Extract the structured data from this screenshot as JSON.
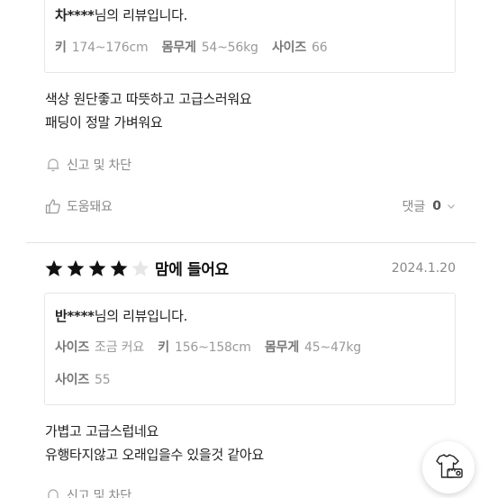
{
  "review1": {
    "reviewer_name": "차****",
    "reviewer_suffix": "님의 리뷰입니다.",
    "specs": [
      {
        "key": "키",
        "value": "174~176cm"
      },
      {
        "key": "몸무게",
        "value": "54~56kg"
      },
      {
        "key": "사이즈",
        "value": "66"
      }
    ],
    "body_lines": [
      "색상 원단좋고 따뜻하고 고급스러워요",
      "패딩이 정말 가벼워요"
    ],
    "report_label": "신고 및 차단",
    "helpful_label": "도움돼요",
    "comments_label": "댓글",
    "comments_count": "0"
  },
  "review2": {
    "rating": 4,
    "max_rating": 5,
    "rating_text": "맘에 들어요",
    "date": "2024.1.20",
    "reviewer_name": "반****",
    "reviewer_suffix": "님의 리뷰입니다.",
    "specs_row1": [
      {
        "key": "사이즈",
        "value": "조금 커요"
      },
      {
        "key": "키",
        "value": "156~158cm"
      },
      {
        "key": "몸무게",
        "value": "45~47kg"
      }
    ],
    "specs_row2": [
      {
        "key": "사이즈",
        "value": "55"
      }
    ],
    "body_lines": [
      "가볍고 고급스럽네요",
      "유행타지않고 오래입을수 있을것 같아요"
    ],
    "report_label": "신고 및 차단"
  },
  "colors": {
    "star_filled": "#111111",
    "star_empty": "#e6e6e6",
    "muted_text": "#888888",
    "border": "#e6e6e6"
  },
  "icons": {
    "bell": "bell-icon",
    "thumbs_up": "thumbs-up-icon",
    "chevron": "chevron-down-icon",
    "fab": "tshirt-tape-icon"
  }
}
